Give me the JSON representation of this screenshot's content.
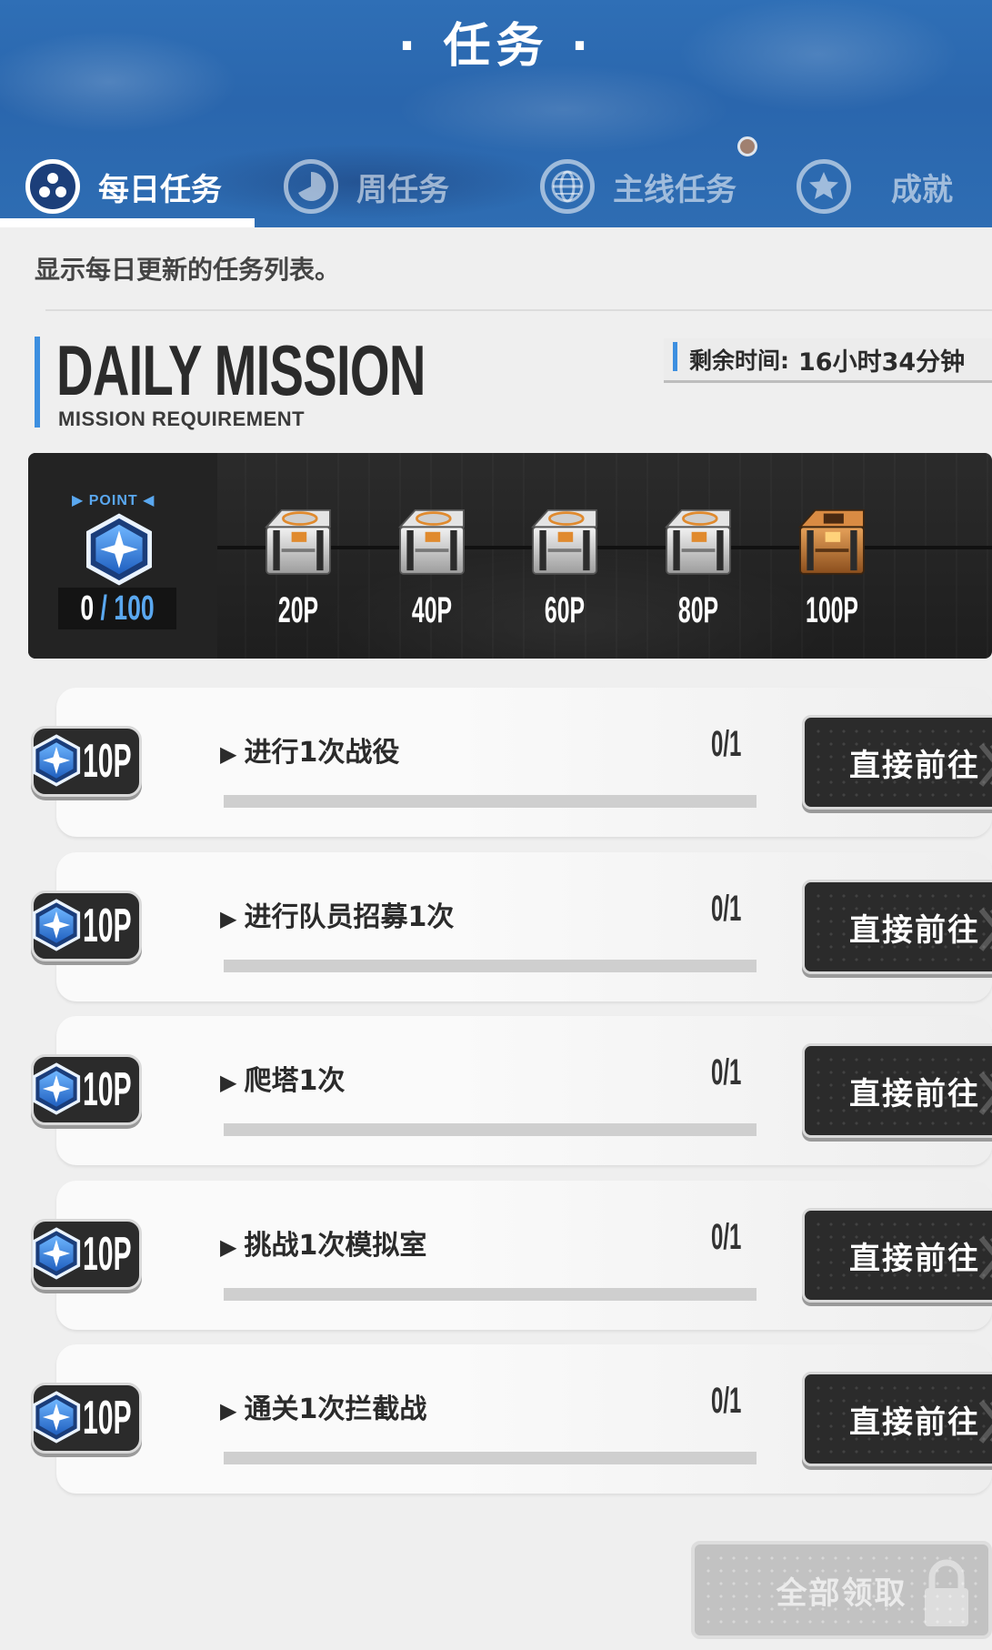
{
  "header": {
    "title": "· 任务 ·",
    "tabs": [
      {
        "label": "每日任务",
        "icon": "daily-icon",
        "active": true
      },
      {
        "label": "周任务",
        "icon": "weekly-icon",
        "active": false
      },
      {
        "label": "主线任务",
        "icon": "globe-icon",
        "active": false
      },
      {
        "label": "成就",
        "icon": "star-icon",
        "active": false
      }
    ]
  },
  "description": "显示每日更新的任务列表。",
  "daily": {
    "title": "DAILY MISSION",
    "subtitle": "MISSION REQUIREMENT",
    "timer_label": "剩余时间:",
    "timer_value": "16小时34分钟"
  },
  "points": {
    "label": "POINT",
    "current": "0",
    "separator": "/",
    "max": "100",
    "milestones": [
      {
        "label": "20P",
        "chest": "silver"
      },
      {
        "label": "40P",
        "chest": "silver"
      },
      {
        "label": "60P",
        "chest": "silver"
      },
      {
        "label": "80P",
        "chest": "silver"
      },
      {
        "label": "100P",
        "chest": "gold"
      }
    ]
  },
  "missions": [
    {
      "reward": "10P",
      "title": "进行1次战役",
      "progress": "0/1",
      "fraction": 0,
      "button": "直接前往"
    },
    {
      "reward": "10P",
      "title": "进行队员招募1次",
      "progress": "0/1",
      "fraction": 0,
      "button": "直接前往"
    },
    {
      "reward": "10P",
      "title": "爬塔1次",
      "progress": "0/1",
      "fraction": 0,
      "button": "直接前往"
    },
    {
      "reward": "10P",
      "title": "挑战1次模拟室",
      "progress": "0/1",
      "fraction": 0,
      "button": "直接前往"
    },
    {
      "reward": "10P",
      "title": "通关1次拦截战",
      "progress": "0/1",
      "fraction": 0,
      "button": "直接前往"
    }
  ],
  "footer": {
    "claim_all": "全部领取"
  },
  "colors": {
    "accent_blue": "#3d8fe0",
    "header_blue": "#2a66ad",
    "dark_button": "#2b2b2b"
  }
}
